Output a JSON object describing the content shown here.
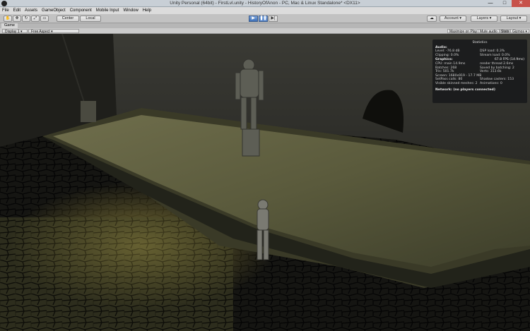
{
  "window": {
    "title": "Unity Personal (64bit) - FirstLvl.unity - HistoryOfAnon - PC, Mac & Linux Standalone* <DX11>",
    "minimize": "—",
    "maximize": "□",
    "close": "✕"
  },
  "menu": [
    "File",
    "Edit",
    "Assets",
    "GameObject",
    "Component",
    "Mobile Input",
    "Window",
    "Help"
  ],
  "toolbar": {
    "pivot": "Center",
    "space": "Local",
    "account": "Account",
    "layers": "Layers",
    "layout": "Layout",
    "cloud": "☁"
  },
  "tab": {
    "game": "Game"
  },
  "gamebar": {
    "display": "Display 1",
    "aspect": "Free Aspect",
    "maximize": "Maximize on Play",
    "mute": "Mute audio",
    "stats": "Stats",
    "gizmos": "Gizmos"
  },
  "stats": {
    "header": "Statistics",
    "audio_title": "Audio:",
    "level": "Level: -76.8 dB",
    "dsp": "DSP load: 0.3%",
    "clipping": "Clipping: 0.0%",
    "stream": "Stream load: 0.0%",
    "graphics_title": "Graphics:",
    "fps": "67.8 FPS (14.9ms)",
    "cpu": "CPU: main 14.9ms",
    "render": "render thread 2.6ms",
    "batches": "Batches: 268",
    "saved": "Saved by batching: 2",
    "tris": "Tris: 501.7k",
    "verts": "Verts: 313.6k",
    "screen": "Screen: 1680x919 - 17.7 MB",
    "setpass": "SetPass calls: 80",
    "shadow": "Shadow casters: 153",
    "skinned": "Visible skinned meshes: 2",
    "anim": "Animations: 0",
    "network": "Network: (no players connected)"
  }
}
